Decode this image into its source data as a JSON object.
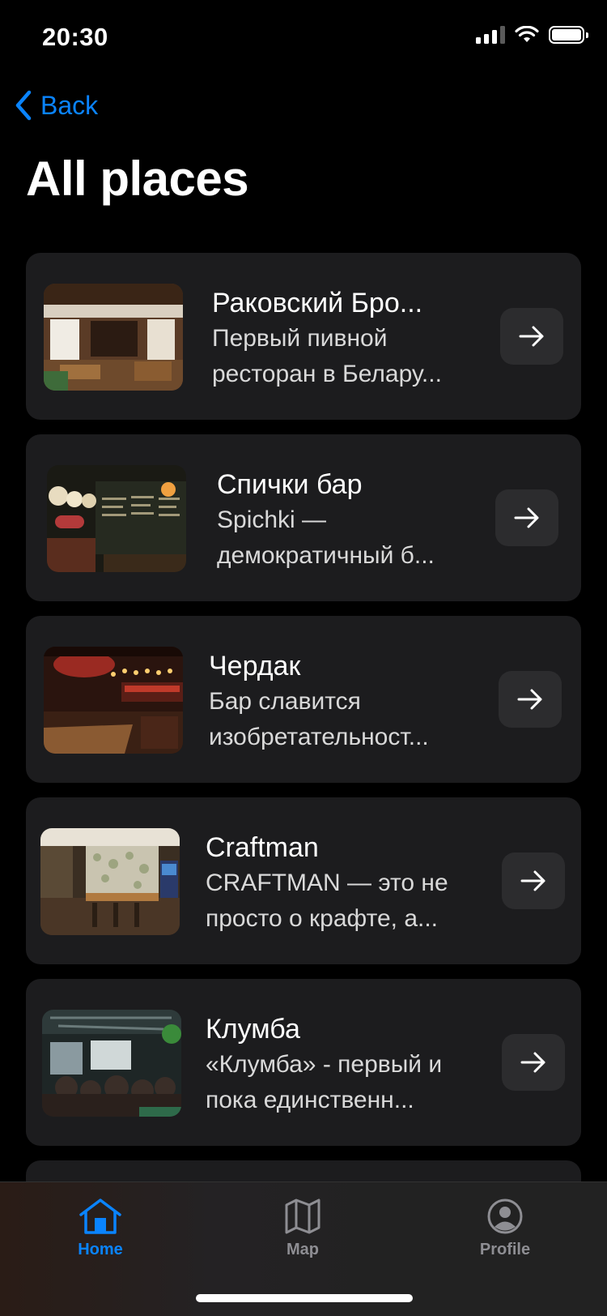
{
  "status_bar": {
    "time": "20:30"
  },
  "nav": {
    "back_label": "Back",
    "title": "All places"
  },
  "places": [
    {
      "title": "Раковский Бро...",
      "description": "Первый пивной ресторан в Белару..."
    },
    {
      "title": "Спички бар",
      "description": "Spichki — демократичный б..."
    },
    {
      "title": "Чердак",
      "description": "Бар славится изобретательност..."
    },
    {
      "title": "Craftman",
      "description": "CRAFTMAN — это не просто о крафте, а..."
    },
    {
      "title": "Клумба",
      "description": "«Клумба» - первый и пока единственн..."
    }
  ],
  "tabs": [
    {
      "label": "Home",
      "icon": "house-icon",
      "active": true
    },
    {
      "label": "Map",
      "icon": "map-icon",
      "active": false
    },
    {
      "label": "Profile",
      "icon": "person-circle-icon",
      "active": false
    }
  ],
  "colors": {
    "accent": "#0a84ff",
    "card": "#1c1c1e",
    "button": "#2c2c2e",
    "inactive": "#8e8e93"
  }
}
